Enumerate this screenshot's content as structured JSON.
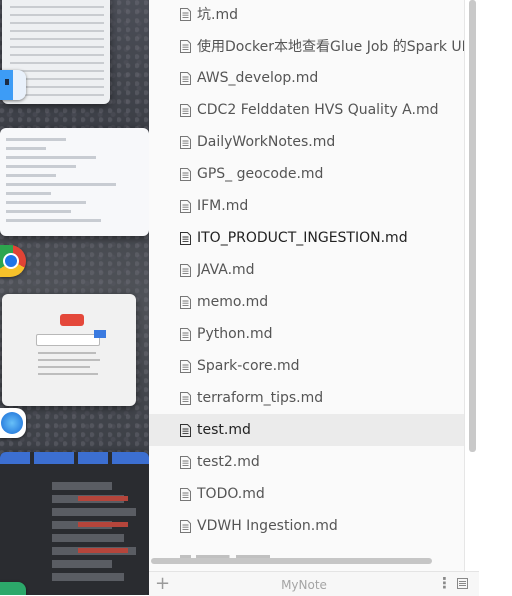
{
  "app": {
    "footer_title": "MyNote"
  },
  "colors": {
    "active_row": "#ebebeb",
    "sidebar_bg": "#fafafa",
    "text": "#555555"
  },
  "files": [
    {
      "name": "坑.md"
    },
    {
      "name": "使用Docker本地查看Glue Job 的Spark UI.md"
    },
    {
      "name": "AWS_develop.md"
    },
    {
      "name": "CDC2 Felddaten HVS Quality A.md"
    },
    {
      "name": "DailyWorkNotes.md"
    },
    {
      "name": "GPS_ geocode.md"
    },
    {
      "name": "IFM.md"
    },
    {
      "name": "ITO_PRODUCT_INGESTION.md",
      "bold": true
    },
    {
      "name": "JAVA.md"
    },
    {
      "name": "memo.md"
    },
    {
      "name": "Python.md"
    },
    {
      "name": "Spark-core.md"
    },
    {
      "name": "terraform_tips.md"
    },
    {
      "name": "test.md",
      "active": true
    },
    {
      "name": "test2.md"
    },
    {
      "name": "TODO.md"
    },
    {
      "name": "VDWH Ingestion.md"
    }
  ],
  "icons": {
    "file": "document-icon",
    "add": "plus-icon",
    "more": "vertical-dots-icon",
    "outline": "outline-panel-icon",
    "dock": [
      "finder-icon",
      "chrome-icon",
      "safari-icon"
    ]
  },
  "footer": {
    "add_label": "+",
    "more_label": "⋮"
  }
}
